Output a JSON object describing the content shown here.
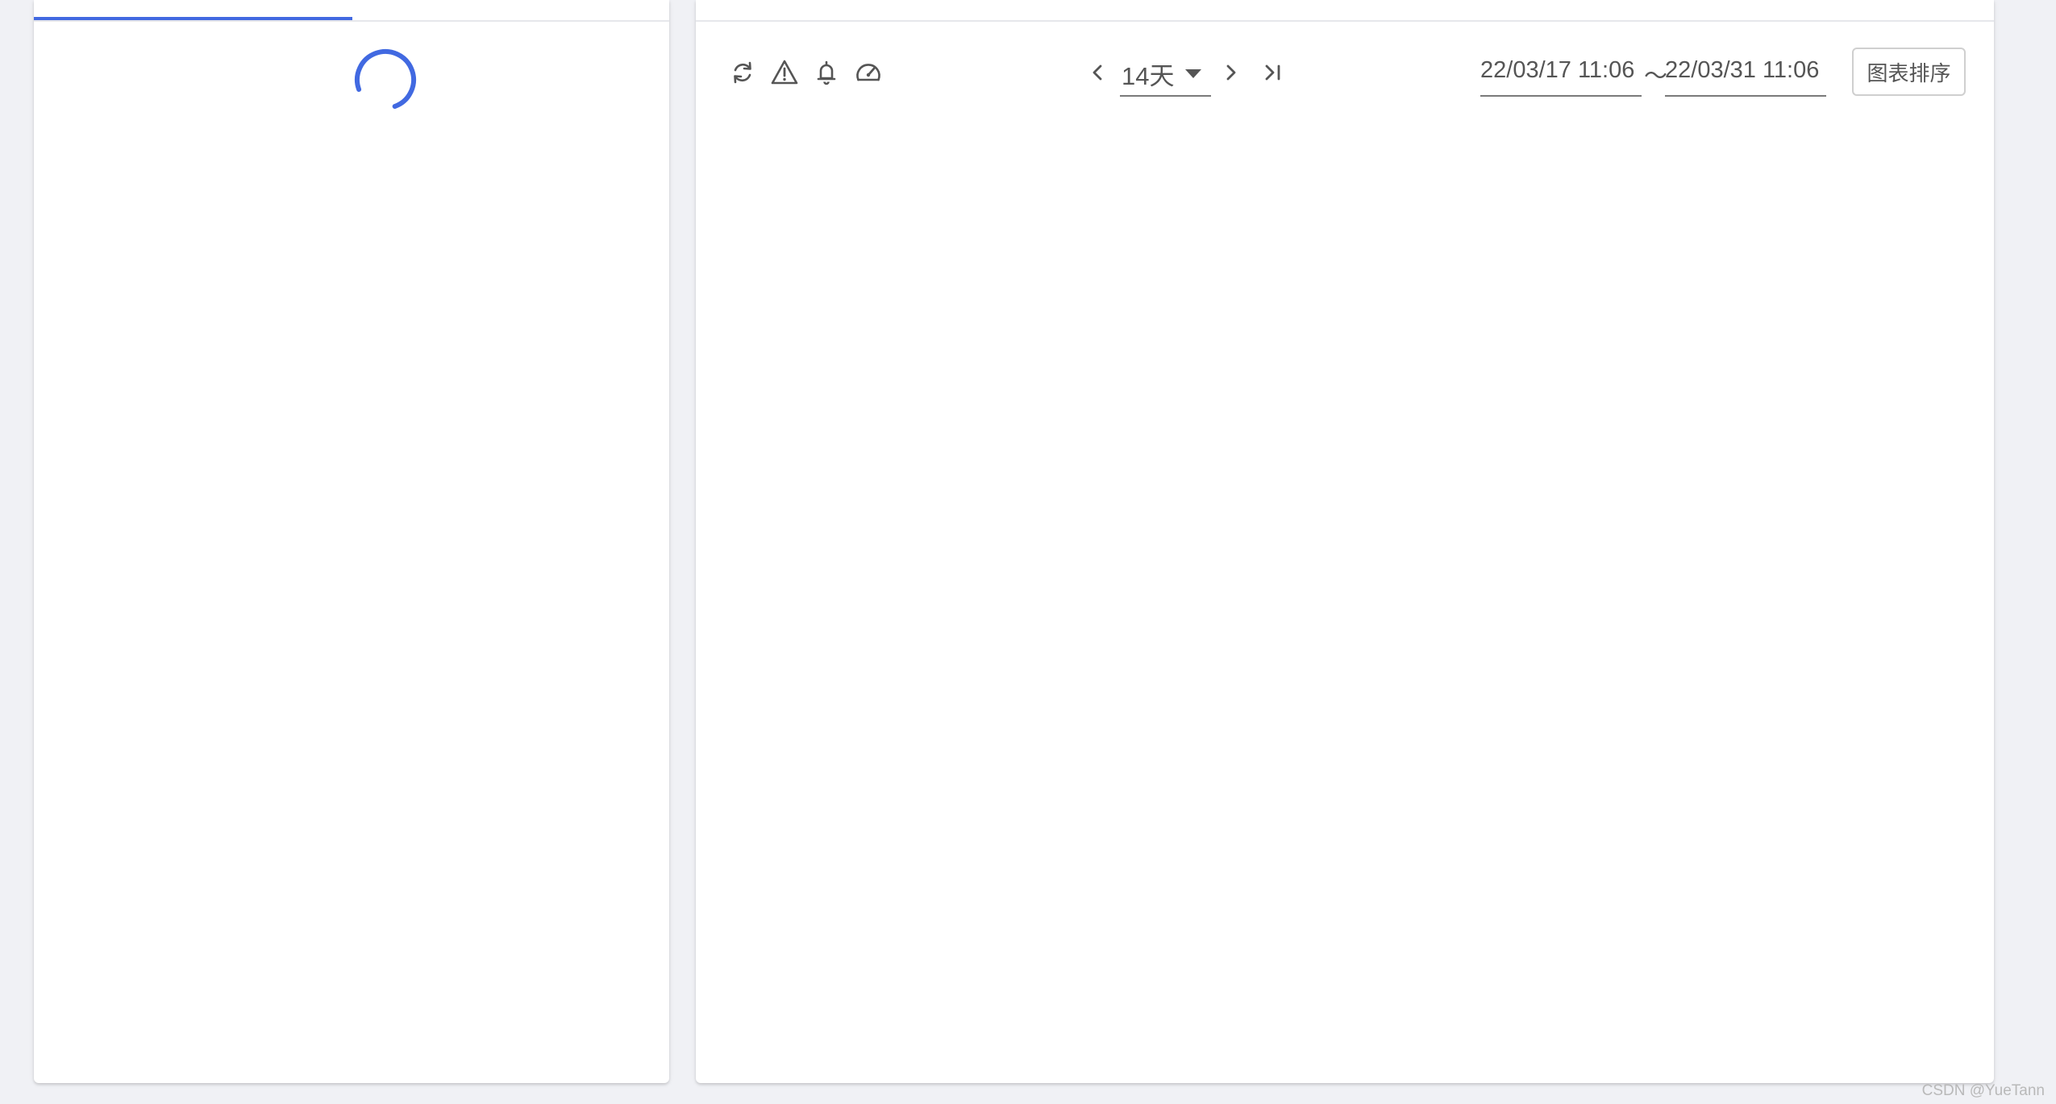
{
  "left_panel": {
    "loading": true
  },
  "toolbar": {
    "icons": {
      "refresh": "refresh-icon",
      "warning": "warning-icon",
      "bell": "bell-icon",
      "gauge": "gauge-icon",
      "prev": "chevron-left-icon",
      "next": "chevron-right-icon",
      "last": "skip-to-end-icon"
    },
    "range_value": "14天",
    "date_start": "22/03/17 11:06",
    "date_separator": "～",
    "date_end": "22/03/31 11:06",
    "sort_label": "图表排序"
  },
  "watermark": "CSDN @YueTann",
  "colors": {
    "accent": "#4169e1",
    "background": "#f0f1f5",
    "text": "#555555"
  }
}
